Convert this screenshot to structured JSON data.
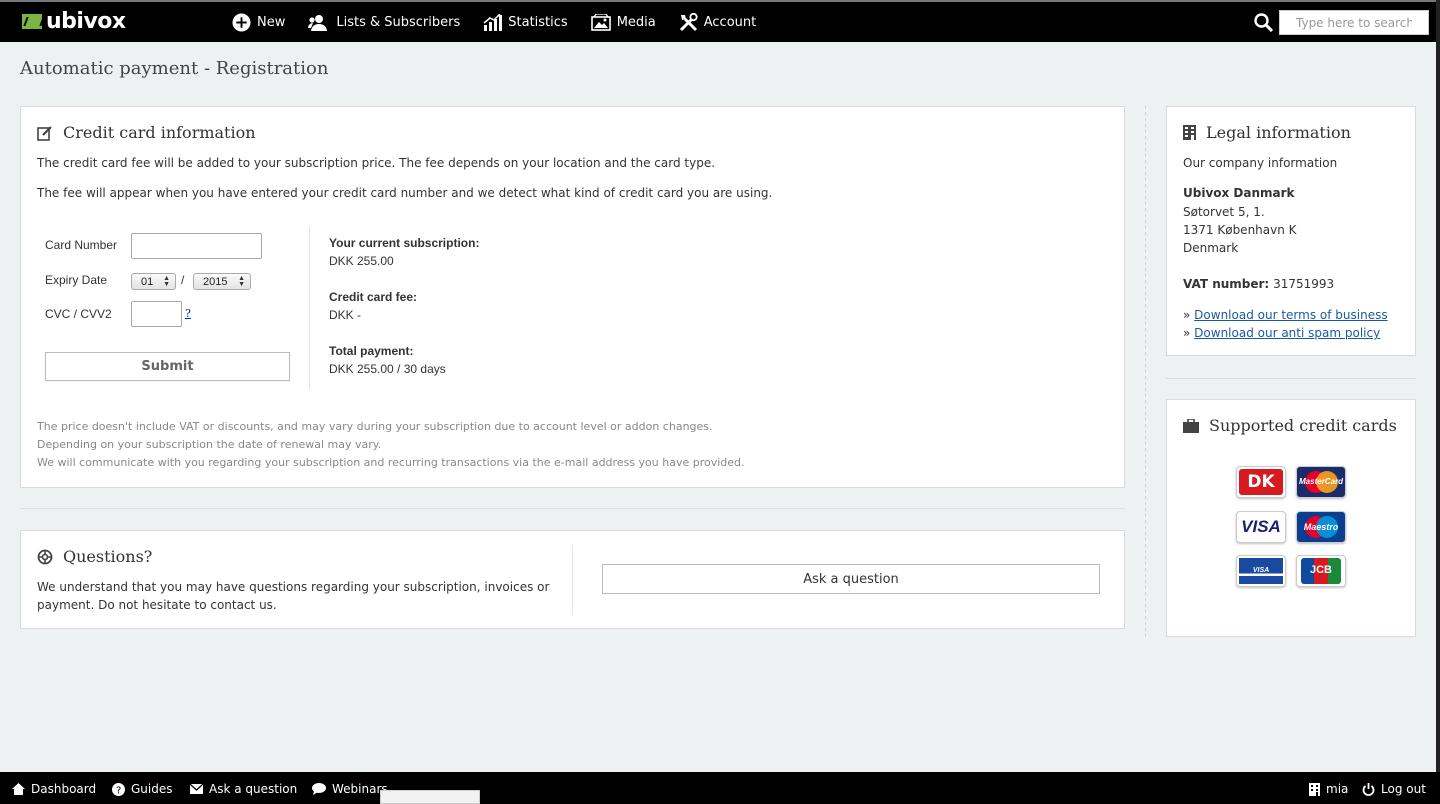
{
  "brand": {
    "name": "ubivox"
  },
  "nav": {
    "items": [
      {
        "label": "New",
        "icon": "plus-circle-icon"
      },
      {
        "label": "Lists & Subscribers",
        "icon": "users-icon"
      },
      {
        "label": "Statistics",
        "icon": "bar-chart-icon"
      },
      {
        "label": "Media",
        "icon": "image-icon"
      },
      {
        "label": "Account",
        "icon": "tools-icon"
      }
    ],
    "search_placeholder": "Type here to search"
  },
  "page_title": "Automatic payment - Registration",
  "credit_card": {
    "title": "Credit card information",
    "intro1": "The credit card fee will be added to your subscription price. The fee depends on your location and the card type.",
    "intro2": "The fee will appear when you have entered your credit card number and we detect what kind of credit card you are using.",
    "card_number_label": "Card Number",
    "expiry_label": "Expiry Date",
    "expiry_month": "01",
    "expiry_separator": "/",
    "expiry_year": "2015",
    "cvc_label": "CVC / CVV2",
    "cvc_help": "?",
    "submit_label": "Submit",
    "summary": {
      "current_label": "Your current subscription:",
      "current_value": "DKK 255.00",
      "fee_label": "Credit card fee:",
      "fee_value": "DKK -",
      "total_label": "Total payment:",
      "total_value": "DKK 255.00 / 30 days"
    },
    "notes": [
      "The price doesn't include VAT or discounts, and may vary during your subscription due to account level or addon changes.",
      "Depending on your subscription the date of renewal may vary.",
      "We will communicate with you regarding your subscription and recurring transactions via the e-mail address you have provided."
    ]
  },
  "questions": {
    "title": "Questions?",
    "text1": "We understand that you may have questions regarding your subscription, invoices or",
    "text2": "payment. Do not hesitate to contact us.",
    "ask_label": "Ask a question"
  },
  "legal": {
    "title": "Legal information",
    "subtitle": "Our company information",
    "company": "Ubivox Danmark",
    "address1": "Søtorvet 5, 1.",
    "address2": "1371 København K",
    "country": "Denmark",
    "vat_label": "VAT number:",
    "vat_value": "31751993",
    "bullet": "»",
    "terms_link": "Download our terms of business",
    "antispam_link": "Download our anti spam policy"
  },
  "cards": {
    "title": "Supported credit cards",
    "items": [
      "DK",
      "MasterCard",
      "VISA",
      "Maestro",
      "VISA ELECTRON",
      "JCB"
    ]
  },
  "footer": {
    "left": [
      {
        "label": "Dashboard",
        "icon": "home-icon"
      },
      {
        "label": "Guides",
        "icon": "help-circle-icon"
      },
      {
        "label": "Ask a question",
        "icon": "mail-icon"
      },
      {
        "label": "Webinars",
        "icon": "chat-icon"
      }
    ],
    "user": "mia",
    "logout": "Log out"
  },
  "colors": {
    "topbar": "#000000",
    "brand_green": "#7cb342",
    "link": "#1a5aa0"
  }
}
